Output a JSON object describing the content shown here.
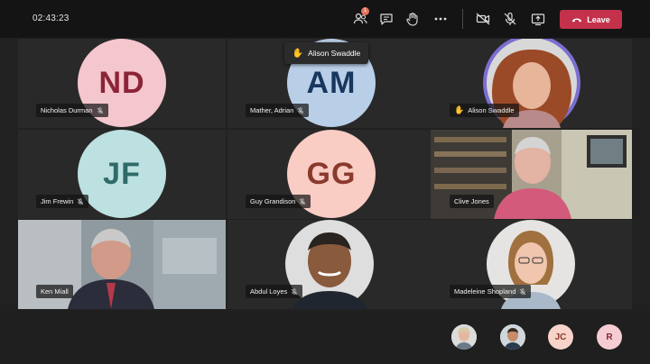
{
  "meeting": {
    "timer": "02:43:23",
    "badge_count": "1",
    "leave_label": "Leave"
  },
  "tooltip": {
    "label": "Alison Swaddle"
  },
  "tiles": [
    {
      "initials": "ND",
      "name": "Nicholas Durman"
    },
    {
      "initials": "AM",
      "name": "Mather, Adrian"
    },
    {
      "initials": "",
      "name": "Alison Swaddle"
    },
    {
      "initials": "JF",
      "name": "Jim Frewin"
    },
    {
      "initials": "GG",
      "name": "Guy Grandison"
    },
    {
      "initials": "",
      "name": "Clive Jones"
    },
    {
      "initials": "",
      "name": "Ken Miall"
    },
    {
      "initials": "",
      "name": "Abdul Loyes"
    },
    {
      "initials": "",
      "name": "Madeleine Shopland"
    }
  ],
  "overflow": [
    {
      "initials": ""
    },
    {
      "initials": ""
    },
    {
      "initials": "JC"
    },
    {
      "initials": "R"
    }
  ],
  "colors": {
    "nd_bg": "#f4c6cd",
    "nd_fg": "#8b2437",
    "am_bg": "#b9cfe8",
    "am_fg": "#17375e",
    "jf_bg": "#bde0e0",
    "jf_fg": "#2f6b68",
    "gg_bg": "#f9cdc4",
    "gg_fg": "#8a3a2c",
    "leave": "#c4314b",
    "raised_hand": "#f1b13b"
  }
}
